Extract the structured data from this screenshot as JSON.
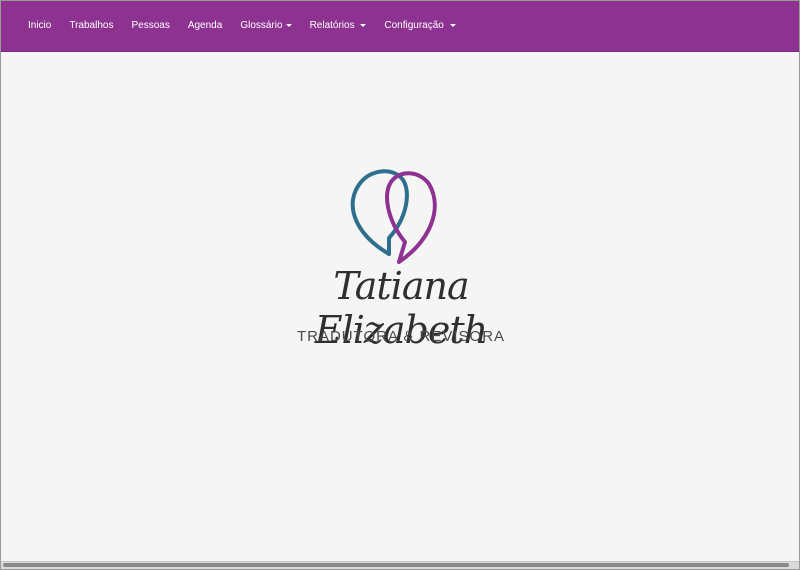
{
  "nav": {
    "items": [
      {
        "label": "Inicio",
        "dropdown": false
      },
      {
        "label": "Trabalhos",
        "dropdown": false
      },
      {
        "label": "Pessoas",
        "dropdown": false
      },
      {
        "label": "Agenda",
        "dropdown": false
      },
      {
        "label": "Glossário",
        "dropdown": true
      },
      {
        "label": "Relatórios",
        "dropdown": true
      },
      {
        "label": "Configuração",
        "dropdown": true
      }
    ]
  },
  "logo": {
    "name": "Tatiana Elizabeth",
    "tagline": "TRADUTORA & REVISORA",
    "colors": {
      "left_bubble": "#2e6f8e",
      "right_bubble": "#8d3291",
      "text": "#2f2f2f"
    }
  },
  "colors": {
    "navbar": "#8d3291",
    "background": "#f5f5f5"
  }
}
